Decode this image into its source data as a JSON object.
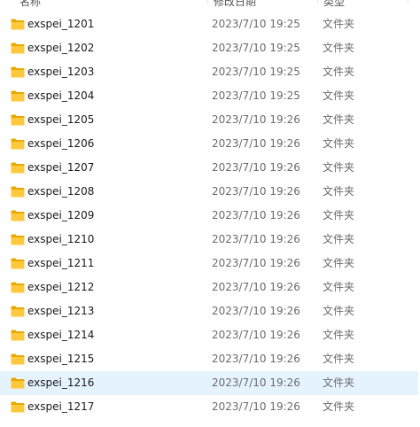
{
  "header": {
    "name_label": "名称",
    "date_label": "修改日期",
    "type_label": "类型"
  },
  "rows": [
    {
      "name": "exspei_1201",
      "date": "2023/7/10 19:25",
      "type": "文件夹"
    },
    {
      "name": "exspei_1202",
      "date": "2023/7/10 19:25",
      "type": "文件夹"
    },
    {
      "name": "exspei_1203",
      "date": "2023/7/10 19:25",
      "type": "文件夹"
    },
    {
      "name": "exspei_1204",
      "date": "2023/7/10 19:25",
      "type": "文件夹"
    },
    {
      "name": "exspei_1205",
      "date": "2023/7/10 19:26",
      "type": "文件夹"
    },
    {
      "name": "exspei_1206",
      "date": "2023/7/10 19:26",
      "type": "文件夹"
    },
    {
      "name": "exspei_1207",
      "date": "2023/7/10 19:26",
      "type": "文件夹"
    },
    {
      "name": "exspei_1208",
      "date": "2023/7/10 19:26",
      "type": "文件夹"
    },
    {
      "name": "exspei_1209",
      "date": "2023/7/10 19:26",
      "type": "文件夹"
    },
    {
      "name": "exspei_1210",
      "date": "2023/7/10 19:26",
      "type": "文件夹"
    },
    {
      "name": "exspei_1211",
      "date": "2023/7/10 19:26",
      "type": "文件夹"
    },
    {
      "name": "exspei_1212",
      "date": "2023/7/10 19:26",
      "type": "文件夹"
    },
    {
      "name": "exspei_1213",
      "date": "2023/7/10 19:26",
      "type": "文件夹"
    },
    {
      "name": "exspei_1214",
      "date": "2023/7/10 19:26",
      "type": "文件夹"
    },
    {
      "name": "exspei_1215",
      "date": "2023/7/10 19:26",
      "type": "文件夹"
    },
    {
      "name": "exspei_1216",
      "date": "2023/7/10 19:26",
      "type": "文件夹"
    },
    {
      "name": "exspei_1217",
      "date": "2023/7/10 19:26",
      "type": "文件夹"
    }
  ],
  "selected_row": "exspei_1216",
  "colors": {
    "folder": "#ffc83d",
    "folder_dark": "#e8a800",
    "selection": "#e5f3ff"
  },
  "icons": {
    "folder": "folder-icon"
  }
}
